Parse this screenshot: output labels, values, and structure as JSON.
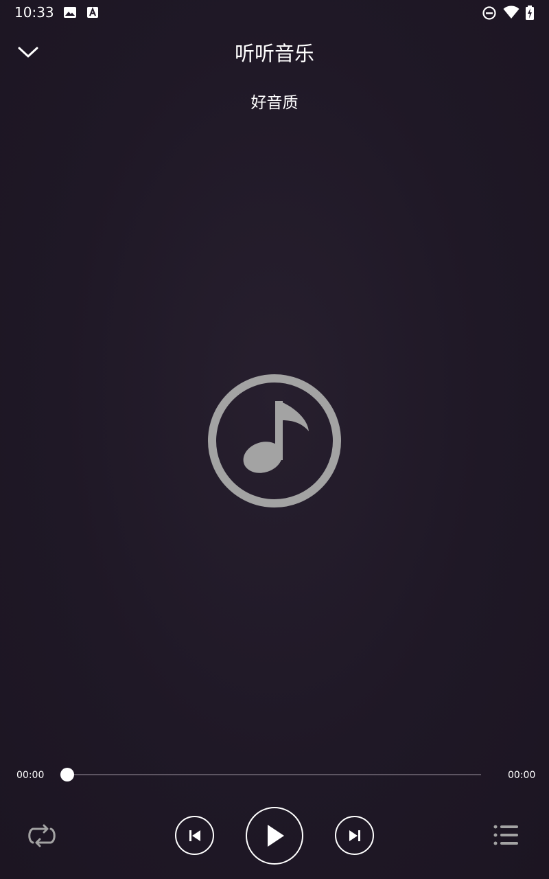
{
  "status_bar": {
    "time": "10:33",
    "left_icons": [
      "image-icon",
      "text-a-icon"
    ],
    "right_icons": [
      "do-not-disturb-icon",
      "wifi-icon",
      "battery-charging-icon"
    ]
  },
  "header": {
    "title": "听听音乐",
    "subtitle": "好音质",
    "back_icon": "chevron-down-icon"
  },
  "artwork": {
    "icon": "music-note-icon",
    "color": "#a3a3a3"
  },
  "progress": {
    "current_time": "00:00",
    "total_time": "00:00",
    "fraction": 0
  },
  "controls": {
    "repeat_icon": "repeat-icon",
    "previous_icon": "skip-previous-icon",
    "play_icon": "play-icon",
    "next_icon": "skip-next-icon",
    "playlist_icon": "playlist-icon"
  },
  "colors": {
    "background": "#1e1625",
    "foreground": "#ffffff",
    "muted_icon": "#a3a3a3",
    "track": "#5d5562"
  }
}
